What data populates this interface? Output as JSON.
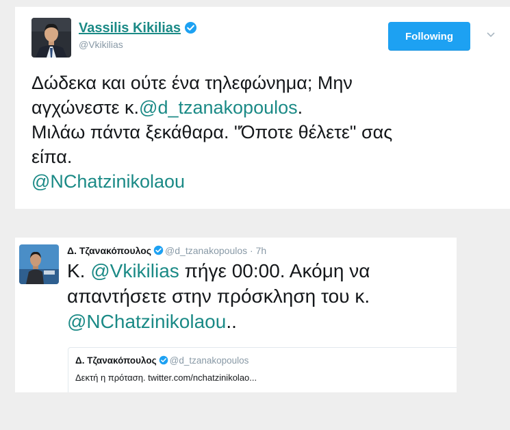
{
  "main_tweet": {
    "author_name": "Vassilis Kikilias",
    "author_handle": "@Vkikilias",
    "follow_button_label": "Following",
    "text_line1": "Δώδεκα και ούτε ένα τηλεφώνημα; Μην",
    "text_line2_pre": "αγχώνεστε κ.",
    "mention_1": "@d_tzanakopoulos",
    "text_line2_post": ".",
    "text_line3": "Μιλάω πάντα ξεκάθαρα. \"Όποτε θέλετε\" σας",
    "text_line4": "είπα.",
    "mention_2": "@NChatzinikolaou"
  },
  "embedded_tweet": {
    "author_name": "Δ. Τζανακόπουλος",
    "author_handle": "@d_tzanakopoulos",
    "separator": "·",
    "timestamp": "7h",
    "text_pre": "Κ. ",
    "mention_1": "@Vkikilias",
    "text_mid": " πήγε 00:00. Ακόμη να απαντήσετε στην πρόσκληση του κ.",
    "mention_2": "@NChatzinikolaou",
    "text_post": ".."
  },
  "quoted_tweet": {
    "author_name": "Δ. Τζανακόπουλος",
    "author_handle": "@d_tzanakopoulos",
    "text": "Δεκτή η πρόταση. twitter.com/nchatzinikolao..."
  },
  "colors": {
    "mention": "#1b8a86",
    "follow_button": "#1da1f2",
    "verified": "#1da1f2",
    "muted_text": "#8899a6"
  },
  "icons": [
    "verified-badge-icon",
    "chevron-down-icon"
  ]
}
